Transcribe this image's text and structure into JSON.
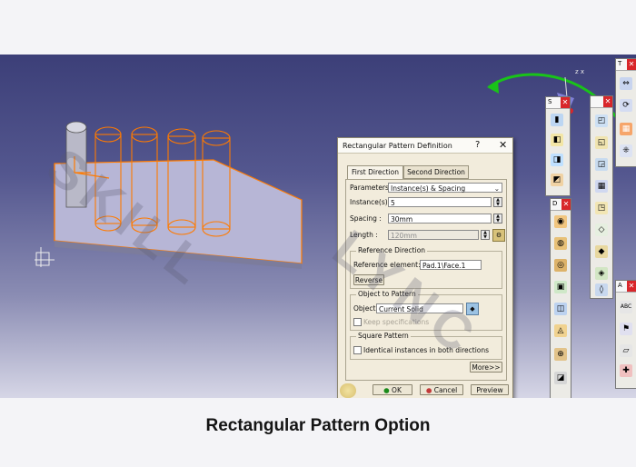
{
  "watermark": {
    "line1": "SKILL",
    "line2": "LYNC"
  },
  "caption": "Rectangular Pattern Option",
  "dialog": {
    "title": "Rectangular Pattern Definition",
    "help": "?",
    "close": "✕",
    "tabs": [
      "First Direction",
      "Second Direction"
    ],
    "parameters_label": "Parameters:",
    "parameters_value": "Instance(s) & Spacing",
    "instances_label": "Instance(s) :",
    "instances_value": "5",
    "spacing_label": "Spacing :",
    "spacing_value": "30mm",
    "length_label": "Length :",
    "length_value": "120mm",
    "ref_dir_label": "Reference Direction",
    "ref_elem_label": "Reference element:",
    "ref_elem_value": "Pad.1\\Face.1",
    "reverse": "Reverse",
    "object_label": "Object to Pattern",
    "object_field_label": "Object:",
    "object_value": "Current Solid",
    "keep_spec": "Keep specifications",
    "square_label": "Square Pattern",
    "identical": "Identical instances in both directions",
    "more": "More>>",
    "ok": "OK",
    "cancel": "Cancel",
    "preview": "Preview"
  },
  "axis_label": "z x",
  "toolbar_s": "S",
  "toolbar_d": "D",
  "toolbar_t": "T",
  "toolbar_a": "A",
  "colors": {
    "highlight": "#ff7a00",
    "annotation": "#19c319",
    "close": "#d8262a"
  }
}
